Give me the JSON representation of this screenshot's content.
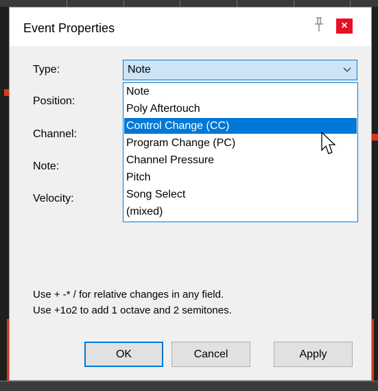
{
  "dialog": {
    "title": "Event Properties",
    "close_glyph": "×",
    "pin_icon": "pin-icon"
  },
  "fields": {
    "type_label": "Type:",
    "position_label": "Position:",
    "channel_label": "Channel:",
    "note_label": "Note:",
    "velocity_label": "Velocity:"
  },
  "type_select": {
    "value": "Note",
    "options": [
      "Note",
      "Poly Aftertouch",
      "Control Change (CC)",
      "Program Change (PC)",
      "Channel Pressure",
      "Pitch",
      "Song Select",
      "(mixed)"
    ],
    "highlighted_index": 2
  },
  "hints": {
    "line1": "Use + -* / for relative changes in any field.",
    "line2": "Use +1o2  to add 1 octave and 2 semitones."
  },
  "buttons": {
    "ok": "OK",
    "cancel": "Cancel",
    "apply": "Apply"
  },
  "colors": {
    "accent": "#0078d7",
    "close": "#e81123",
    "marker": "#d23a1a"
  }
}
